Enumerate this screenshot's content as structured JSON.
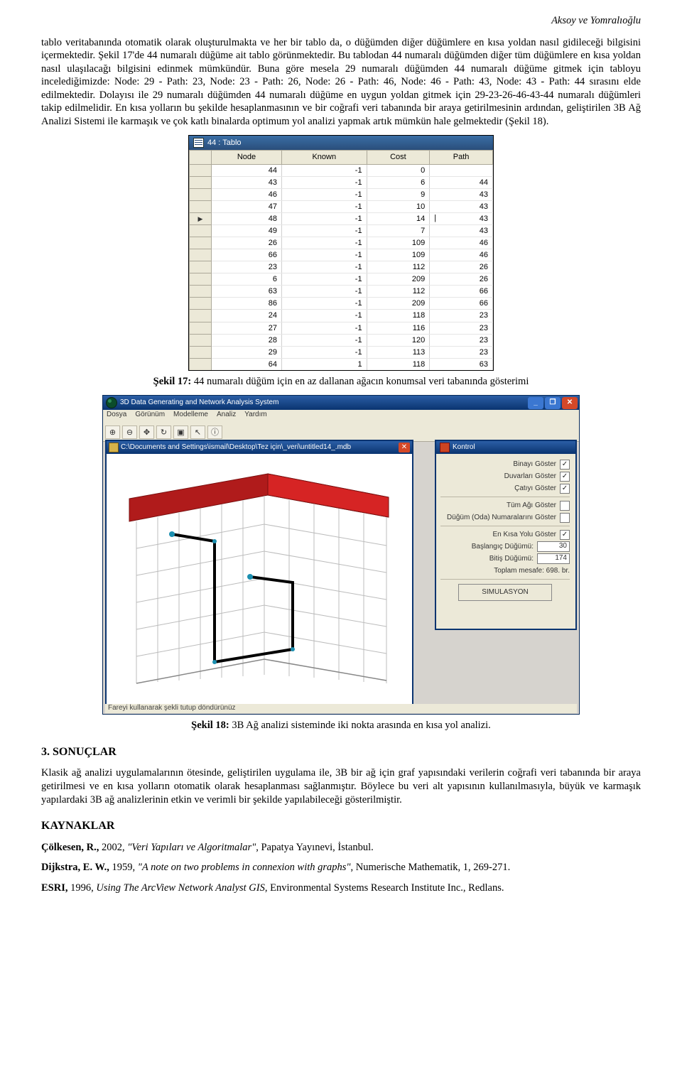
{
  "header_right": "Aksoy ve Yomralıoğlu",
  "para1": "tablo veritabanında otomatik olarak oluşturulmakta ve her bir tablo da, o düğümden diğer düğümlere en kısa yoldan nasıl gidileceği bilgisini içermektedir. Şekil 17'de 44 numaralı düğüme ait tablo görünmektedir. Bu tablodan 44 numaralı düğümden diğer tüm düğümlere en kısa yoldan nasıl ulaşılacağı bilgisini edinmek mümkündür. Buna göre mesela 29 numaralı düğümden 44 numaralı düğüme gitmek için tabloyu incelediğimizde: Node: 29 - Path: 23, Node: 23 - Path: 26, Node: 26 - Path: 46, Node: 46 - Path: 43, Node: 43 - Path: 44 sırasını elde edilmektedir. Dolayısı ile 29 numaralı düğümden 44 numaralı düğüme en uygun yoldan gitmek için 29-23-26-46-43-44 numaralı düğümleri takip edilmelidir. En kısa yolların bu şekilde hesaplanmasının ve bir coğrafi veri tabanında bir araya getirilmesinin ardından, geliştirilen 3B Ağ Analizi Sistemi ile karmaşık ve çok katlı binalarda optimum yol analizi yapmak artık mümkün hale gelmektedir (Şekil 18).",
  "fig17": {
    "window_title": "44 : Tablo",
    "columns": [
      "Node",
      "Known",
      "Cost",
      "Path"
    ],
    "rows": [
      {
        "node": "44",
        "known": "-1",
        "cost": "0",
        "path": ""
      },
      {
        "node": "43",
        "known": "-1",
        "cost": "6",
        "path": "44"
      },
      {
        "node": "46",
        "known": "-1",
        "cost": "9",
        "path": "43"
      },
      {
        "node": "47",
        "known": "-1",
        "cost": "10",
        "path": "43"
      },
      {
        "node": "48",
        "known": "-1",
        "cost": "14",
        "path": "43",
        "pointer": true,
        "caret": "|"
      },
      {
        "node": "49",
        "known": "-1",
        "cost": "7",
        "path": "43"
      },
      {
        "node": "26",
        "known": "-1",
        "cost": "109",
        "path": "46"
      },
      {
        "node": "66",
        "known": "-1",
        "cost": "109",
        "path": "46"
      },
      {
        "node": "23",
        "known": "-1",
        "cost": "112",
        "path": "26"
      },
      {
        "node": "6",
        "known": "-1",
        "cost": "209",
        "path": "26"
      },
      {
        "node": "63",
        "known": "-1",
        "cost": "112",
        "path": "66"
      },
      {
        "node": "86",
        "known": "-1",
        "cost": "209",
        "path": "66"
      },
      {
        "node": "24",
        "known": "-1",
        "cost": "118",
        "path": "23"
      },
      {
        "node": "27",
        "known": "-1",
        "cost": "116",
        "path": "23"
      },
      {
        "node": "28",
        "known": "-1",
        "cost": "120",
        "path": "23"
      },
      {
        "node": "29",
        "known": "-1",
        "cost": "113",
        "path": "23"
      },
      {
        "node": "64",
        "known": "1",
        "cost": "118",
        "path": "63",
        "half": true
      }
    ],
    "caption_bold": "Şekil 17:",
    "caption_rest": " 44 numaralı düğüm için en az dallanan ağacın konumsal veri tabanında gösterimi"
  },
  "fig18": {
    "app_title": "3D Data Generating and Network Analysis System",
    "menus": [
      "Dosya",
      "Görünüm",
      "Modelleme",
      "Analiz",
      "Yardım"
    ],
    "doc_title": "C:\\Documents and Settings\\ismail\\Desktop\\Tez için\\_veri\\untitled14_.mdb",
    "status": "Fareyi kullanarak şekli tutup döndürünüz",
    "kontrol_title": "Kontrol",
    "kontrol": {
      "line1": "Binayı Göster",
      "line2": "Duvarları Göster",
      "line3": "Çatıyı Göster",
      "line4": "Tüm Ağı Göster",
      "line5": "Düğüm (Oda) Numaralarını Göster",
      "line6": "En Kısa Yolu Göster",
      "line7": "Başlangıç Düğümü:",
      "line7v": "30",
      "line8": "Bitiş Düğümü:",
      "line8v": "174",
      "line9": "Toplam mesafe:  698. br.",
      "button": "SIMULASYON"
    },
    "caption_bold": "Şekil 18:",
    "caption_rest": " 3B Ağ analizi sisteminde iki nokta arasında en kısa yol analizi."
  },
  "section3": "3. SONUÇLAR",
  "para3": "Klasik ağ analizi uygulamalarının ötesinde, geliştirilen uygulama ile, 3B bir ağ için graf yapısındaki verilerin coğrafi veri tabanında bir araya getirilmesi ve en kısa yolların otomatik olarak hesaplanması sağlanmıştır. Böylece bu veri alt yapısının kullanılmasıyla, büyük ve karmaşık yapılardaki 3B ağ analizlerinin etkin ve verimli bir şekilde yapılabileceği gösterilmiştir.",
  "kaynaklar": "KAYNAKLAR",
  "ref1": {
    "a": "Çölkesen,   R.,",
    "y": "   2002,   ",
    "t": "\"Veri   Yapıları   ve   Algoritmalar\"",
    "r": ",   Papatya   Yayınevi,   İstanbul."
  },
  "ref2": {
    "a": "Dijkstra, E. W.,",
    "y": " 1959, ",
    "t": "\"A note on two problems in connexion with graphs\"",
    "r": ", Numerische Mathematik, 1, 269-271."
  },
  "ref3": {
    "a": "ESRI,",
    "y": " 1996, ",
    "t": "Using The ArcView Network Analyst GIS",
    "r": ", Environmental Systems Research Institute Inc., Redlans."
  }
}
